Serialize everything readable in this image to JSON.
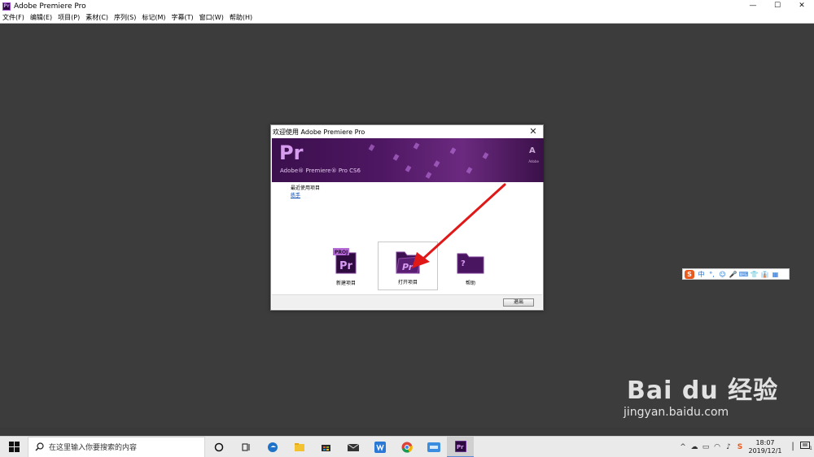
{
  "window": {
    "app_icon_text": "Pr",
    "title": "Adobe Premiere Pro",
    "controls": [
      "—",
      "☐",
      "✕"
    ]
  },
  "menubar": {
    "items": [
      "文件(F)",
      "编辑(E)",
      "项目(P)",
      "素材(C)",
      "序列(S)",
      "标记(M)",
      "字幕(T)",
      "窗口(W)",
      "帮助(H)"
    ]
  },
  "dialog": {
    "title": "欢迎使用 Adobe Premiere Pro",
    "close": "✕",
    "banner": {
      "logo": "Pr",
      "product": "Adobe® Premiere® Pro CS6",
      "adobe_mark": "A",
      "adobe_text": "Adobe"
    },
    "recent_label": "最近使用项目",
    "recent_items": [
      "练手"
    ],
    "actions": [
      {
        "label": "新建项目",
        "icon": "new-project-icon",
        "badge": "PROJ",
        "glyph": "Pr"
      },
      {
        "label": "打开项目",
        "icon": "open-project-icon",
        "glyph": "Pr"
      },
      {
        "label": "帮助",
        "icon": "help-icon",
        "glyph": "?"
      }
    ],
    "exit_label": "退出"
  },
  "ime": {
    "logo": "S",
    "items": [
      "中",
      "°,",
      "☺",
      "🎤",
      "⌨",
      "👕",
      "👔",
      "▦"
    ]
  },
  "watermark": {
    "brand": "Bai du 经验",
    "url": "jingyan.baidu.com"
  },
  "taskbar": {
    "search_placeholder": "在这里输入你要搜索的内容",
    "pinned": [
      "cortana-icon",
      "task-view-icon",
      "edge-icon",
      "file-explorer-icon",
      "store-icon",
      "mail-icon",
      "wps-icon",
      "chrome-icon",
      "ime-app-icon",
      "premiere-icon"
    ],
    "clock_time": "18:07",
    "clock_date": "2019/12/1",
    "notification_count": "1"
  },
  "colors": {
    "premiere_purple": "#4e1762",
    "arrow_red": "#e01818",
    "workspace": "#3c3c3c"
  }
}
